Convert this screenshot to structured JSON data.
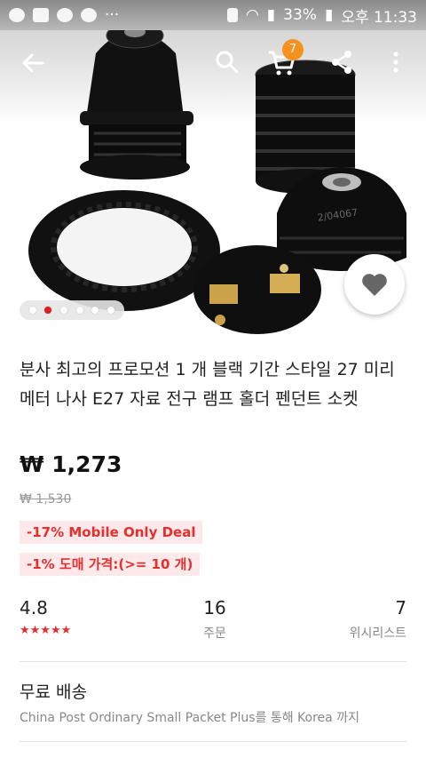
{
  "status_bar": {
    "battery": "33%",
    "time": "오후 11:33"
  },
  "app_bar": {
    "cart_count": "7"
  },
  "gallery": {
    "dot_count": 6,
    "active_index": 1
  },
  "product": {
    "title": "분사 최고의 프로모션 1 개 블랙 기간 스타일 27 미리메터 나사 E27 자료 전구 램프 홀더 펜던트 소켓",
    "price": "₩ 1,273",
    "original_price": "₩ 1,530",
    "tags": [
      "-17% Mobile Only Deal",
      "-1% 도매 가격:(>= 10 개)"
    ]
  },
  "stats": {
    "rating": "4.8",
    "stars": "★★★★★",
    "orders": "16",
    "orders_label": "주문",
    "wishlist": "7",
    "wishlist_label": "위시리스트"
  },
  "shipping": {
    "title": "무료 배송",
    "description": "China Post Ordinary Small Packet Plus를 통해 Korea 까지"
  },
  "colors": {
    "accent_red": "#e62e2e",
    "badge_orange": "#f5911e"
  },
  "icons": [
    "back-arrow-icon",
    "search-icon",
    "cart-icon",
    "share-icon",
    "more-vert-icon",
    "heart-icon"
  ]
}
